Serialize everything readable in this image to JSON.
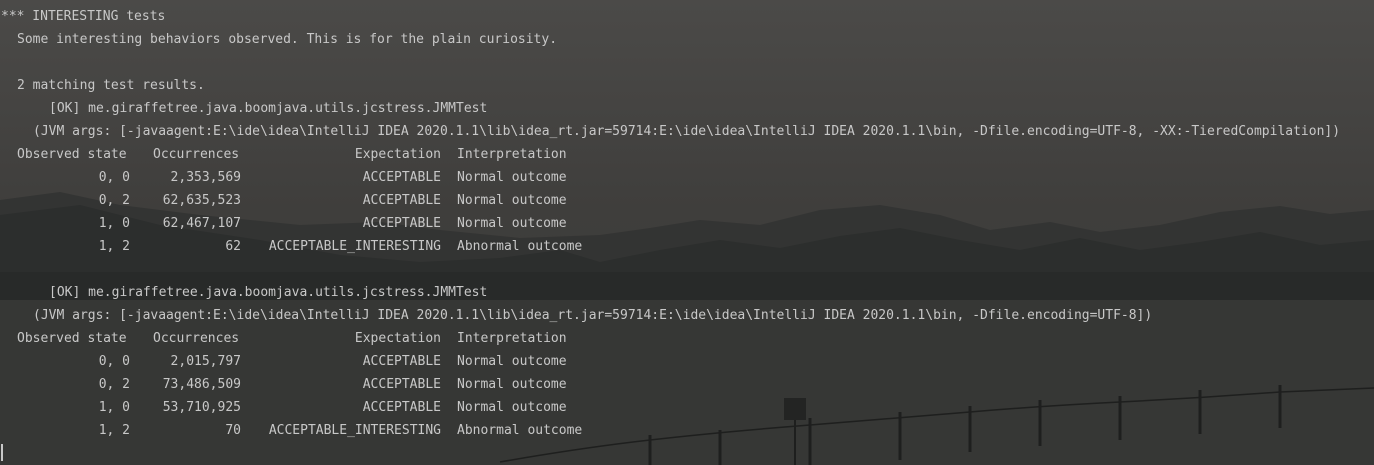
{
  "console": {
    "header": "*** INTERESTING tests",
    "description": "Some interesting behaviors observed. This is for the plain curiosity.",
    "match_count": "2 matching test results.",
    "results": [
      {
        "status": "[OK] me.giraffetree.java.boomjava.utils.jcstress.JMMTest",
        "jvm_args": "(JVM args: [-javaagent:E:\\ide\\idea\\IntelliJ IDEA 2020.1.1\\lib\\idea_rt.jar=59714:E:\\ide\\idea\\IntelliJ IDEA 2020.1.1\\bin, -Dfile.encoding=UTF-8, -XX:-TieredCompilation])",
        "headers": [
          "Observed state",
          "Occurrences",
          "Expectation",
          "Interpretation"
        ],
        "rows": [
          {
            "state": "0, 0",
            "occurrences": "2,353,569",
            "expectation": "ACCEPTABLE",
            "interpretation": "Normal outcome"
          },
          {
            "state": "0, 2",
            "occurrences": "62,635,523",
            "expectation": "ACCEPTABLE",
            "interpretation": "Normal outcome"
          },
          {
            "state": "1, 0",
            "occurrences": "62,467,107",
            "expectation": "ACCEPTABLE",
            "interpretation": "Normal outcome"
          },
          {
            "state": "1, 2",
            "occurrences": "62",
            "expectation": "ACCEPTABLE_INTERESTING",
            "interpretation": "Abnormal outcome"
          }
        ]
      },
      {
        "status": "[OK] me.giraffetree.java.boomjava.utils.jcstress.JMMTest",
        "jvm_args": "(JVM args: [-javaagent:E:\\ide\\idea\\IntelliJ IDEA 2020.1.1\\lib\\idea_rt.jar=59714:E:\\ide\\idea\\IntelliJ IDEA 2020.1.1\\bin, -Dfile.encoding=UTF-8])",
        "headers": [
          "Observed state",
          "Occurrences",
          "Expectation",
          "Interpretation"
        ],
        "rows": [
          {
            "state": "0, 0",
            "occurrences": "2,015,797",
            "expectation": "ACCEPTABLE",
            "interpretation": "Normal outcome"
          },
          {
            "state": "0, 2",
            "occurrences": "73,486,509",
            "expectation": "ACCEPTABLE",
            "interpretation": "Normal outcome"
          },
          {
            "state": "1, 0",
            "occurrences": "53,710,925",
            "expectation": "ACCEPTABLE",
            "interpretation": "Normal outcome"
          },
          {
            "state": "1, 2",
            "occurrences": "70",
            "expectation": "ACCEPTABLE_INTERESTING",
            "interpretation": "Abnormal outcome"
          }
        ]
      }
    ]
  },
  "colors": {
    "text": "#c8c8c8",
    "sky_top": "#4a4947",
    "sky_bottom": "#3d3c3a",
    "mountains": "#2b2d2c",
    "water": "#353634"
  }
}
